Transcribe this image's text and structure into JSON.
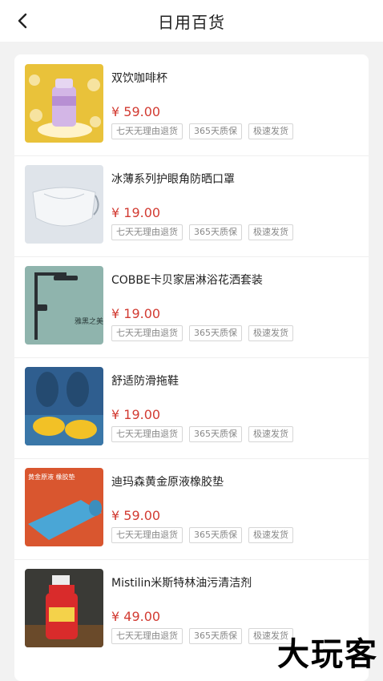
{
  "header": {
    "title": "日用百货"
  },
  "tags": [
    "七天无理由退货",
    "365天质保",
    "极速发货"
  ],
  "products": [
    {
      "name": "双饮咖啡杯",
      "price": "¥ 59.00",
      "thumb_icon": "cup-image"
    },
    {
      "name": "冰薄系列护眼角防晒口罩",
      "price": "¥ 19.00",
      "thumb_icon": "mask-image"
    },
    {
      "name": "COBBE卡贝家居淋浴花洒套装",
      "price": "¥ 19.00",
      "thumb_icon": "shower-image",
      "thumb_text": "雅黑之美 浴出时髦"
    },
    {
      "name": "舒适防滑拖鞋",
      "price": "¥ 19.00",
      "thumb_icon": "slippers-image"
    },
    {
      "name": "迪玛森黄金原液橡胶垫",
      "price": "¥ 59.00",
      "thumb_icon": "yoga-mat-image",
      "thumb_text": "黄金原液 橡胶垫"
    },
    {
      "name": "Mistilin米斯特林油污清洁剂",
      "price": "¥ 49.00",
      "thumb_icon": "cleaner-image"
    }
  ],
  "watermark": "大玩客"
}
